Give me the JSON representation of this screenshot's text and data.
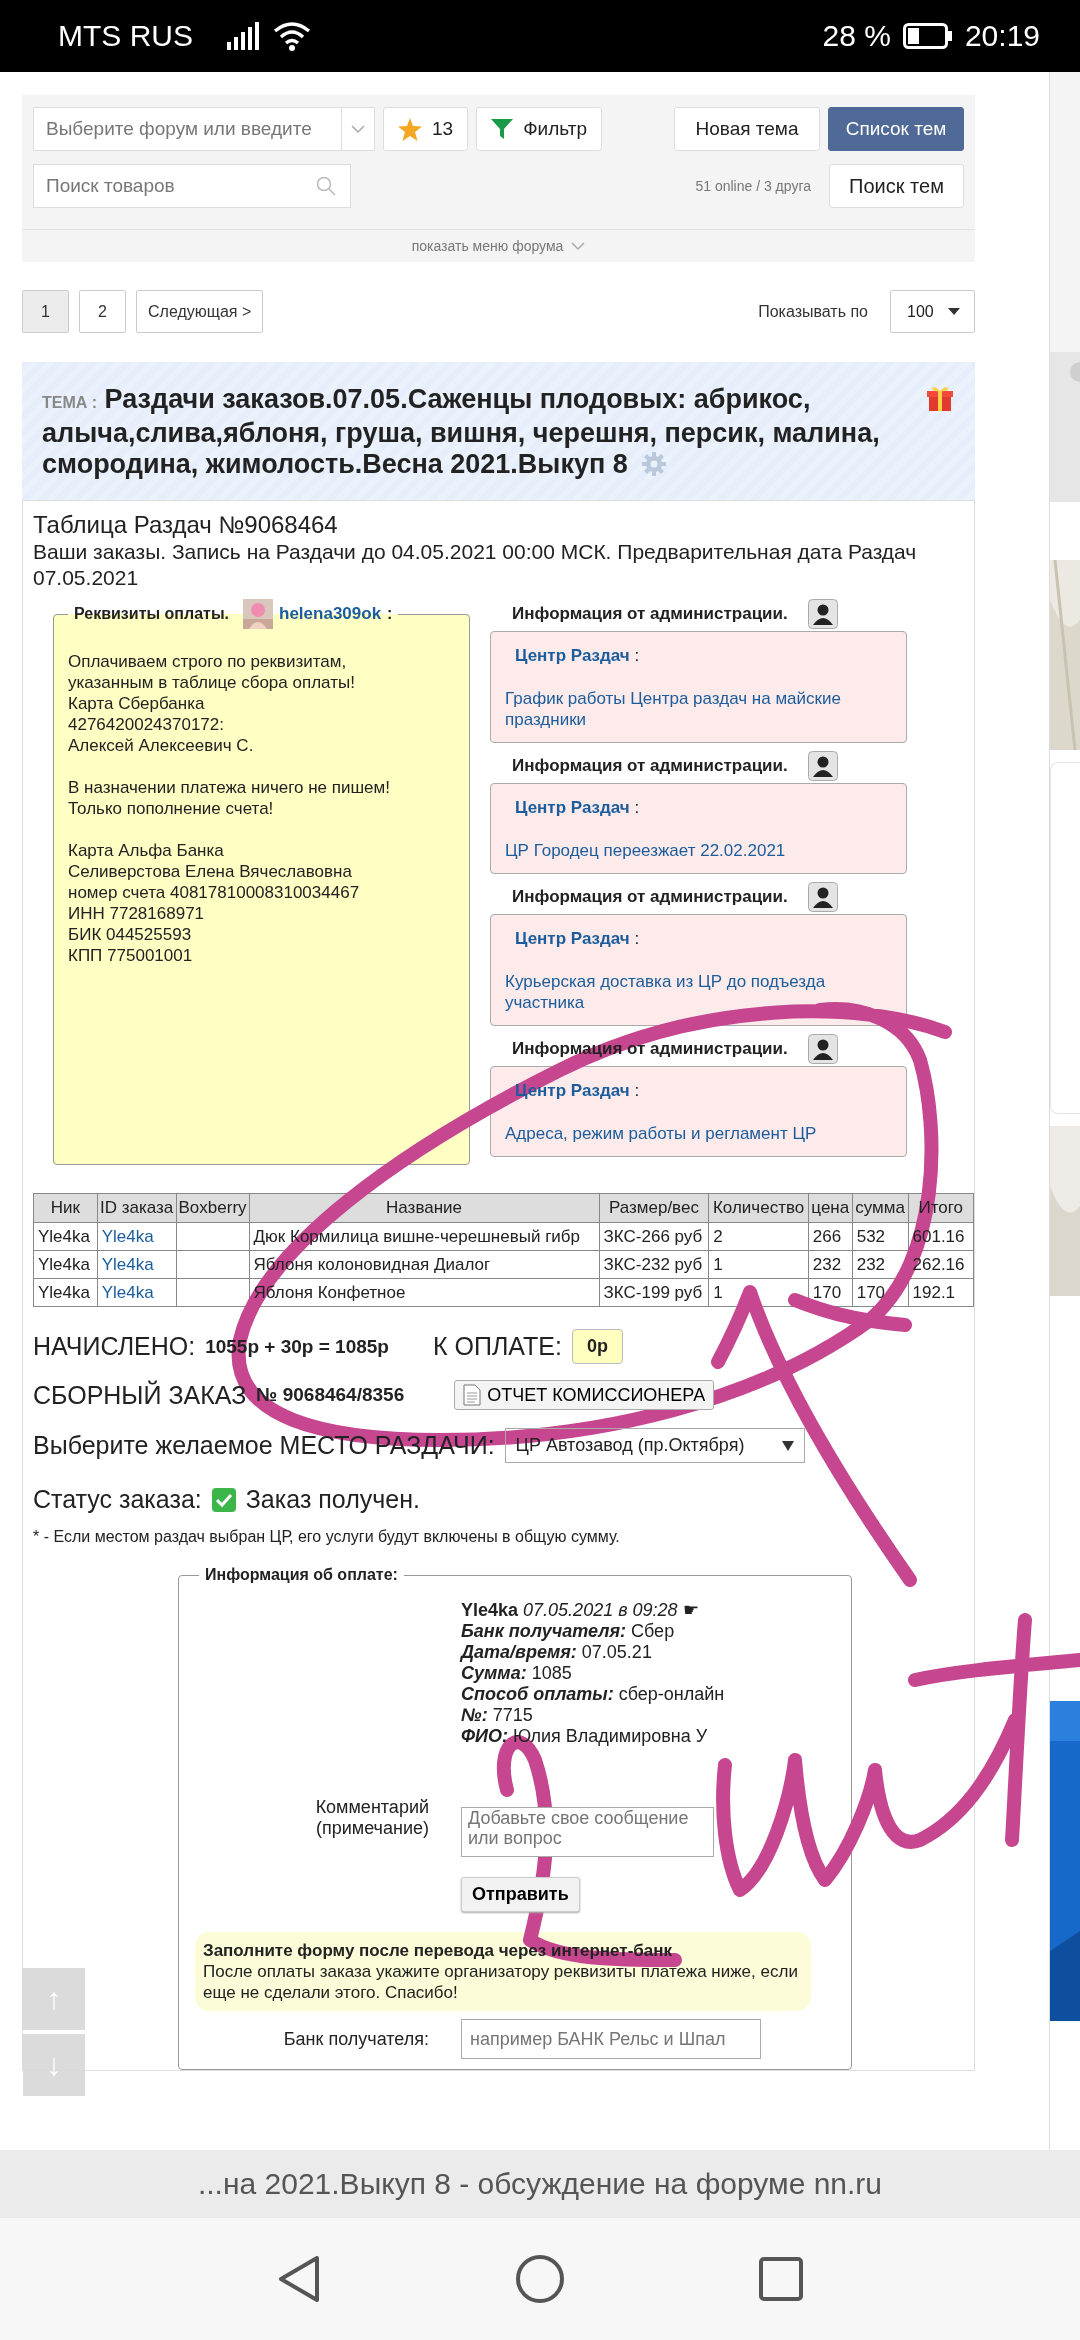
{
  "status_bar": {
    "carrier": "MTS RUS",
    "battery": "28 %",
    "time": "20:19"
  },
  "toolbar": {
    "forum_select": {
      "placeholder": "Выберите форум или введите"
    },
    "favorites_count": "13",
    "filter_button": "Фильтр",
    "new_topic_button": "Новая тема",
    "topic_list_button": "Список тем",
    "search": {
      "placeholder": "Поиск товаров"
    },
    "online": "51 online / 3 друга",
    "search_topics_button": "Поиск тем",
    "menu_toggle": "показать меню форума"
  },
  "pagination": {
    "pages": [
      {
        "label": "1",
        "selected": true
      },
      {
        "label": "2",
        "selected": false
      }
    ],
    "next": "Следующая >",
    "per_page_label": "Показывать по",
    "per_page": "100"
  },
  "topic": {
    "prefix": "ТЕМА :",
    "title": "Раздачи заказов.07.05.Саженцы плодовых: абрикос, алыча,слива,яблоня, груша, вишня, черешня, персик, малина, смородина, жимолость.Весна 2021.Выкуп 8"
  },
  "sheet": {
    "title": "Таблица Раздач №9068464",
    "subtitle": "Ваши заказы. Запись на Раздачи до 04.05.2021 00:00 МСК. Предварительная дата Раздач 07.05.2021"
  },
  "payment_details": {
    "legend": "Реквизиты оплаты.",
    "user": "helena309ok",
    "colon": ":",
    "paragraphs": [
      [
        "Оплачиваем строго по реквизитам,",
        "указанным в таблице сбора оплаты!",
        "Карта Сбербанка",
        "4276420024370172:",
        "Алексей Алексеевич С."
      ],
      [
        "В назначении платежа ничего не пишем!",
        "Только пополнение счета!"
      ],
      [
        "Карта Альфа Банка",
        "Селиверстова Елена Вячеславовна",
        "номер счета 40817810008310034467",
        "ИНН 7728168971",
        "БИК 044525593",
        "КПП 775001001"
      ]
    ]
  },
  "admin_notices": [
    {
      "heading": "Информация от администрации.",
      "source": "Центр Раздач",
      "message": "График работы Центра раздач на майские праздники"
    },
    {
      "heading": "Информация от администрации.",
      "source": "Центр Раздач",
      "message": "ЦР Городец переезжает 22.02.2021"
    },
    {
      "heading": "Информация от администрации.",
      "source": "Центр Раздач",
      "message": "Курьерская доставка из ЦР до подъезда участника"
    },
    {
      "heading": "Информация от администрации.",
      "source": "Центр Раздач",
      "message": "Адреса, режим работы и регламент ЦР"
    }
  ],
  "orders": {
    "columns": [
      "Ник",
      "ID заказа",
      "Boxberry",
      "Название",
      "Размер/вес",
      "Количество",
      "цена",
      "сумма",
      "Итого"
    ],
    "rows": [
      {
        "cells": [
          "Yle4ka",
          "Yle4ka",
          "",
          "Дюк Кормилица вишне-черешневый гибр",
          "ЗКС-266 руб",
          "2",
          "266",
          "532",
          "601.16"
        ]
      },
      {
        "cells": [
          "Yle4ka",
          "Yle4ka",
          "",
          "Яблоня колоновидная Диалог",
          "ЗКС-232 руб",
          "1",
          "232",
          "232",
          "262.16"
        ]
      },
      {
        "cells": [
          "Yle4ka",
          "Yle4ka",
          "",
          "Яблоня Конфетное",
          "ЗКС-199 руб",
          "1",
          "170",
          "170",
          "192.1"
        ]
      }
    ]
  },
  "totals": {
    "accrued_label": "НАЧИСЛЕНО:",
    "accrued": "1055р + 30р = 1085р",
    "due_label": "К ОПЛАТЕ:",
    "due": "0р"
  },
  "combined_order": {
    "label": "СБОРНЫЙ ЗАКАЗ",
    "number": "№ 9068464/8356",
    "report_button": "ОТЧЕТ КОМИССИОНЕРА"
  },
  "pickup": {
    "label": "Выберите желаемое МЕСТО РАЗДАЧИ:",
    "value": "ЦР Автозавод (пр.Октября)"
  },
  "order_status": {
    "label": "Статус заказа:",
    "value": "Заказ получен."
  },
  "footnote": "* - Если местом раздач выбран ЦР, его услуги будут включены в общую сумму.",
  "payment_info": {
    "legend": "Информация об оплате:",
    "user": "Yle4ka",
    "datetime": "07.05.2021 в 09:28",
    "marker": "☛",
    "fields": [
      {
        "label": "Банк получателя:",
        "value": "Сбер"
      },
      {
        "label": "Дата/время:",
        "value": "07.05.21"
      },
      {
        "label": "Сумма:",
        "value": "1085"
      },
      {
        "label": "Способ оплаты:",
        "value": "сбер-онлайн"
      },
      {
        "label": "№:",
        "value": "7715"
      },
      {
        "label": "ФИО:",
        "value": "Юлия Владимировна У"
      }
    ],
    "comment_label": "Комментарий (примечание)",
    "comment": {
      "placeholder": "Добавьте свое сообщение или вопрос"
    },
    "send_button": "Отправить",
    "notice_title": "Заполните форму после перевода через интернет-банк",
    "notice_text": "После оплаты заказа укажите организатору реквизиты платежа ниже, если еще не сделали этого. Спасибо!",
    "bank_label": "Банк получателя:",
    "bank": {
      "placeholder": "например БАНК Рельс и Шпал"
    }
  },
  "scroll_buttons": [
    "↑",
    "↓"
  ],
  "browser_title": "...на 2021.Выкуп 8 - обсуждение на форуме nn.ru",
  "annotation": {
    "kind": "freehand"
  }
}
